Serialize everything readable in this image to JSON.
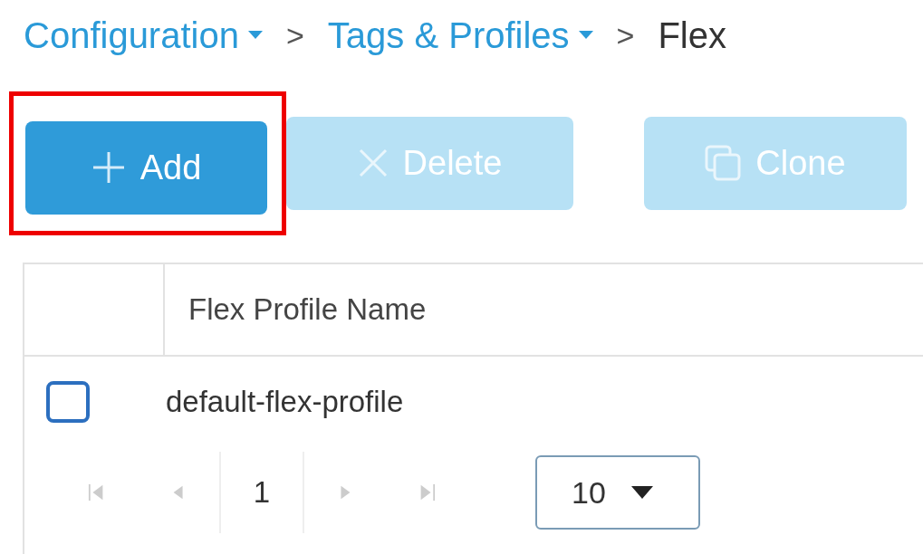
{
  "breadcrumb": [
    {
      "kind": "link",
      "label": "Configuration",
      "dropdown": true
    },
    {
      "kind": "separator",
      "label": ">"
    },
    {
      "kind": "link",
      "label": "Tags & Profiles",
      "dropdown": true
    },
    {
      "kind": "separator",
      "label": ">"
    },
    {
      "kind": "current",
      "label": "Flex"
    }
  ],
  "toolbar": [
    {
      "kind": "add",
      "label": "Add",
      "disabled": false,
      "highlighted": true
    },
    {
      "kind": "delete",
      "label": "Delete",
      "disabled": true,
      "highlighted": false
    },
    {
      "kind": "clone",
      "label": "Clone",
      "disabled": true,
      "highlighted": false
    }
  ],
  "table": {
    "columns": [
      "Flex Profile Name"
    ],
    "rows": [
      {
        "cells": [
          "default-flex-profile"
        ],
        "checked": false
      }
    ]
  },
  "pagination": {
    "page": "1",
    "page_size": "10"
  }
}
